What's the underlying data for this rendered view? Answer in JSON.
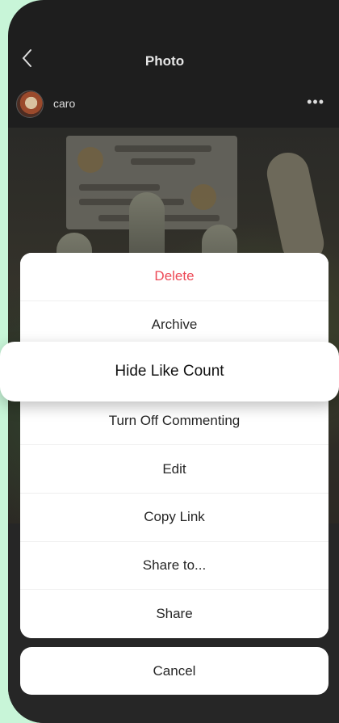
{
  "header": {
    "title": "Photo",
    "back_icon": "chevron-left-icon"
  },
  "post": {
    "username": "caro",
    "more_icon": "more-horizontal-icon"
  },
  "action_sheet": {
    "options": [
      {
        "label": "Delete",
        "style": "destructive"
      },
      {
        "label": "Archive"
      },
      {
        "label": "Hide Like Count"
      },
      {
        "label": "Turn Off Commenting"
      },
      {
        "label": "Edit"
      },
      {
        "label": "Copy Link"
      },
      {
        "label": "Share to..."
      },
      {
        "label": "Share"
      }
    ],
    "cancel_label": "Cancel"
  },
  "colors": {
    "background": "#c8f5d8",
    "destructive": "#ed4956",
    "sheet": "#ffffff"
  }
}
